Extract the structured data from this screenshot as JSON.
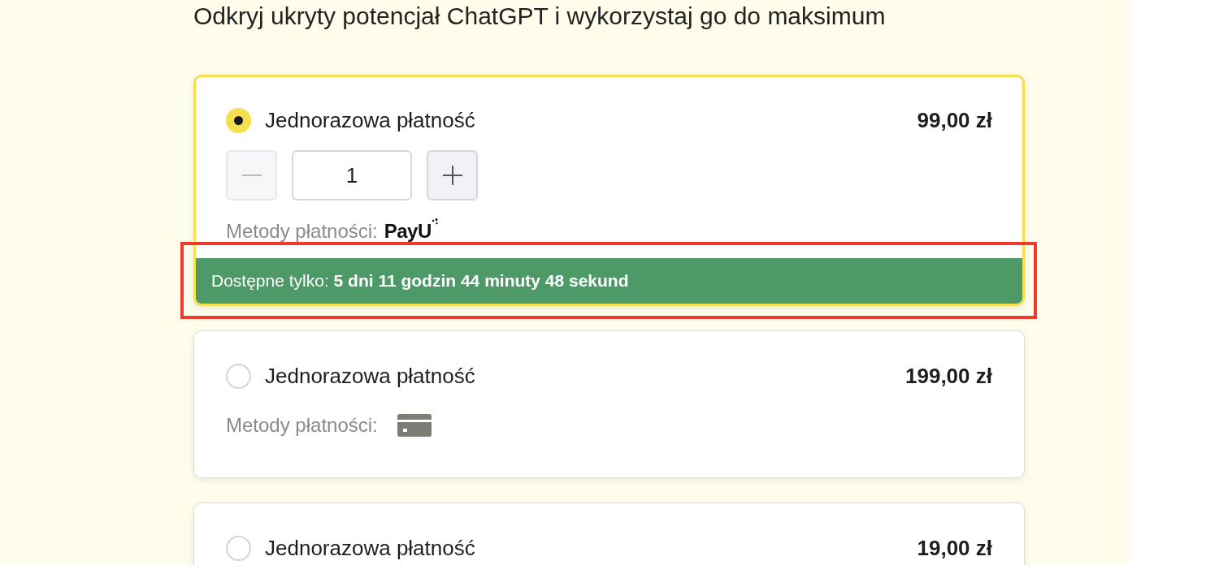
{
  "headline": "Odkryj ukryty potencjał ChatGPT i wykorzystaj go do maksimum",
  "offers": [
    {
      "title": "Jednorazowa płatność",
      "price": "99,00 zł",
      "selected": true,
      "quantity": {
        "value": "1",
        "decrease_disabled": true
      },
      "methods_label": "Metody płatności:",
      "method": {
        "kind": "logo",
        "text": "PayU"
      },
      "timer": {
        "label": "Dostępne tylko:",
        "remaining": "5 dni 11 godzin 44 minuty 48 sekund",
        "highlighted": true
      }
    },
    {
      "title": "Jednorazowa płatność",
      "price": "199,00 zł",
      "selected": false,
      "methods_label": "Metody płatności:",
      "method": {
        "kind": "card"
      }
    },
    {
      "title": "Jednorazowa płatność",
      "price": "19,00 zł",
      "selected": false
    }
  ]
}
